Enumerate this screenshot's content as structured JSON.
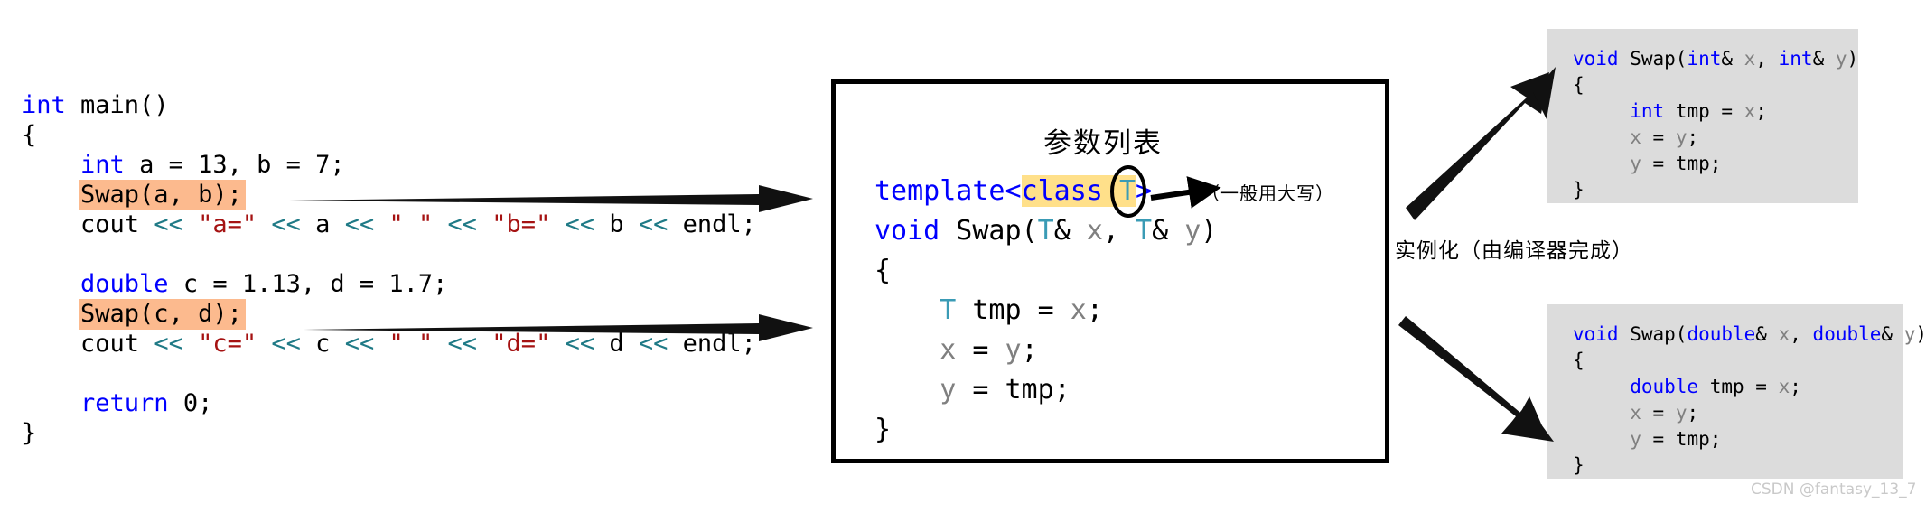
{
  "left_panel": {
    "name": "main-function-code",
    "lines": [
      [
        {
          "t": "int",
          "c": "kw"
        },
        {
          "t": " main()",
          "c": ""
        }
      ],
      [
        {
          "t": "{",
          "c": ""
        }
      ],
      [
        {
          "t": "    ",
          "c": ""
        },
        {
          "t": "int",
          "c": "kw"
        },
        {
          "t": " a = 13, b = 7;",
          "c": ""
        }
      ],
      [
        {
          "t": "    ",
          "c": ""
        },
        {
          "t": "Swap(a, b);",
          "c": "hl-orange"
        }
      ],
      [
        {
          "t": "    cout ",
          "c": ""
        },
        {
          "t": "<<",
          "c": "op"
        },
        {
          "t": " ",
          "c": ""
        },
        {
          "t": "\"a=\"",
          "c": "str"
        },
        {
          "t": " ",
          "c": ""
        },
        {
          "t": "<<",
          "c": "op"
        },
        {
          "t": " a ",
          "c": ""
        },
        {
          "t": "<<",
          "c": "op"
        },
        {
          "t": " ",
          "c": ""
        },
        {
          "t": "\" \"",
          "c": "str"
        },
        {
          "t": " ",
          "c": ""
        },
        {
          "t": "<<",
          "c": "op"
        },
        {
          "t": " ",
          "c": ""
        },
        {
          "t": "\"b=\"",
          "c": "str"
        },
        {
          "t": " ",
          "c": ""
        },
        {
          "t": "<<",
          "c": "op"
        },
        {
          "t": " b ",
          "c": ""
        },
        {
          "t": "<<",
          "c": "op"
        },
        {
          "t": " endl;",
          "c": ""
        }
      ],
      [
        {
          "t": "",
          "c": ""
        }
      ],
      [
        {
          "t": "    ",
          "c": ""
        },
        {
          "t": "double",
          "c": "kw"
        },
        {
          "t": " c = 1.13, d = 1.7;",
          "c": ""
        }
      ],
      [
        {
          "t": "    ",
          "c": ""
        },
        {
          "t": "Swap(c, d);",
          "c": "hl-orange"
        }
      ],
      [
        {
          "t": "    cout ",
          "c": ""
        },
        {
          "t": "<<",
          "c": "op"
        },
        {
          "t": " ",
          "c": ""
        },
        {
          "t": "\"c=\"",
          "c": "str"
        },
        {
          "t": " ",
          "c": ""
        },
        {
          "t": "<<",
          "c": "op"
        },
        {
          "t": " c ",
          "c": ""
        },
        {
          "t": "<<",
          "c": "op"
        },
        {
          "t": " ",
          "c": ""
        },
        {
          "t": "\" \"",
          "c": "str"
        },
        {
          "t": " ",
          "c": ""
        },
        {
          "t": "<<",
          "c": "op"
        },
        {
          "t": " ",
          "c": ""
        },
        {
          "t": "\"d=\"",
          "c": "str"
        },
        {
          "t": " ",
          "c": ""
        },
        {
          "t": "<<",
          "c": "op"
        },
        {
          "t": " d ",
          "c": ""
        },
        {
          "t": "<<",
          "c": "op"
        },
        {
          "t": " endl;",
          "c": ""
        }
      ],
      [
        {
          "t": "",
          "c": ""
        }
      ],
      [
        {
          "t": "    ",
          "c": ""
        },
        {
          "t": "return",
          "c": "kw"
        },
        {
          "t": " 0;",
          "c": ""
        }
      ],
      [
        {
          "t": "}",
          "c": ""
        }
      ]
    ]
  },
  "center_box": {
    "title": "参数列表",
    "type_param_note": "（一般用大写）",
    "lines": [
      [
        {
          "t": "template",
          "c": "kw"
        },
        {
          "t": "<",
          "c": "kw"
        },
        {
          "t": "class ",
          "c": "kw hl-yellow"
        },
        {
          "t": "T",
          "c": "tparam hl-yellow"
        },
        {
          "t": ">",
          "c": "kw"
        }
      ],
      [
        {
          "t": "void",
          "c": "kw"
        },
        {
          "t": " Swap(",
          "c": ""
        },
        {
          "t": "T",
          "c": "tparam"
        },
        {
          "t": "& ",
          "c": ""
        },
        {
          "t": "x",
          "c": "var"
        },
        {
          "t": ", ",
          "c": ""
        },
        {
          "t": "T",
          "c": "tparam"
        },
        {
          "t": "& ",
          "c": ""
        },
        {
          "t": "y",
          "c": "var"
        },
        {
          "t": ")",
          "c": ""
        }
      ],
      [
        {
          "t": "{",
          "c": ""
        }
      ],
      [
        {
          "t": "    ",
          "c": ""
        },
        {
          "t": "T",
          "c": "tparam"
        },
        {
          "t": " tmp = ",
          "c": ""
        },
        {
          "t": "x",
          "c": "var"
        },
        {
          "t": ";",
          "c": ""
        }
      ],
      [
        {
          "t": "    ",
          "c": ""
        },
        {
          "t": "x",
          "c": "var"
        },
        {
          "t": " = ",
          "c": ""
        },
        {
          "t": "y",
          "c": "var"
        },
        {
          "t": ";",
          "c": ""
        }
      ],
      [
        {
          "t": "    ",
          "c": ""
        },
        {
          "t": "y",
          "c": "var"
        },
        {
          "t": " = tmp;",
          "c": ""
        }
      ],
      [
        {
          "t": "}",
          "c": ""
        }
      ]
    ]
  },
  "gray_box_top": {
    "lines": [
      [
        {
          "t": "void",
          "c": "kw"
        },
        {
          "t": " Swap(",
          "c": ""
        },
        {
          "t": "int",
          "c": "kw"
        },
        {
          "t": "& ",
          "c": ""
        },
        {
          "t": "x",
          "c": "var"
        },
        {
          "t": ", ",
          "c": ""
        },
        {
          "t": "int",
          "c": "kw"
        },
        {
          "t": "& ",
          "c": ""
        },
        {
          "t": "y",
          "c": "var"
        },
        {
          "t": ")",
          "c": ""
        }
      ],
      [
        {
          "t": "{",
          "c": ""
        }
      ],
      [
        {
          "t": "     ",
          "c": ""
        },
        {
          "t": "int",
          "c": "kw"
        },
        {
          "t": " tmp = ",
          "c": ""
        },
        {
          "t": "x",
          "c": "var"
        },
        {
          "t": ";",
          "c": ""
        }
      ],
      [
        {
          "t": "     ",
          "c": ""
        },
        {
          "t": "x",
          "c": "var"
        },
        {
          "t": " = ",
          "c": ""
        },
        {
          "t": "y",
          "c": "var"
        },
        {
          "t": ";",
          "c": ""
        }
      ],
      [
        {
          "t": "     ",
          "c": ""
        },
        {
          "t": "y",
          "c": "var"
        },
        {
          "t": " = tmp;",
          "c": ""
        }
      ],
      [
        {
          "t": "}",
          "c": ""
        }
      ]
    ]
  },
  "gray_box_bottom": {
    "lines": [
      [
        {
          "t": "void",
          "c": "kw"
        },
        {
          "t": " Swap(",
          "c": ""
        },
        {
          "t": "double",
          "c": "kw"
        },
        {
          "t": "& ",
          "c": ""
        },
        {
          "t": "x",
          "c": "var"
        },
        {
          "t": ", ",
          "c": ""
        },
        {
          "t": "double",
          "c": "kw"
        },
        {
          "t": "& ",
          "c": ""
        },
        {
          "t": "y",
          "c": "var"
        },
        {
          "t": ")",
          "c": ""
        }
      ],
      [
        {
          "t": "{",
          "c": ""
        }
      ],
      [
        {
          "t": "     ",
          "c": ""
        },
        {
          "t": "double",
          "c": "kw"
        },
        {
          "t": " tmp = ",
          "c": ""
        },
        {
          "t": "x",
          "c": "var"
        },
        {
          "t": ";",
          "c": ""
        }
      ],
      [
        {
          "t": "     ",
          "c": ""
        },
        {
          "t": "x",
          "c": "var"
        },
        {
          "t": " = ",
          "c": ""
        },
        {
          "t": "y",
          "c": "var"
        },
        {
          "t": ";",
          "c": ""
        }
      ],
      [
        {
          "t": "     ",
          "c": ""
        },
        {
          "t": "y",
          "c": "var"
        },
        {
          "t": " = tmp;",
          "c": ""
        }
      ],
      [
        {
          "t": "}",
          "c": ""
        }
      ]
    ]
  },
  "annotations": {
    "instantiate": "实例化（由编译器完成）",
    "watermark": "CSDN @fantasy_13_7"
  },
  "colors": {
    "keyword": "#0000ff",
    "string": "#a51212",
    "stream_operator": "#1f7a86",
    "type_param": "#3a9bb5",
    "variable_grey": "#808080",
    "highlight_orange": "#fcba8e",
    "highlight_yellow": "#ffe08a",
    "gray_box_bg": "#dcdcdc",
    "watermark": "#c9c9c9"
  }
}
